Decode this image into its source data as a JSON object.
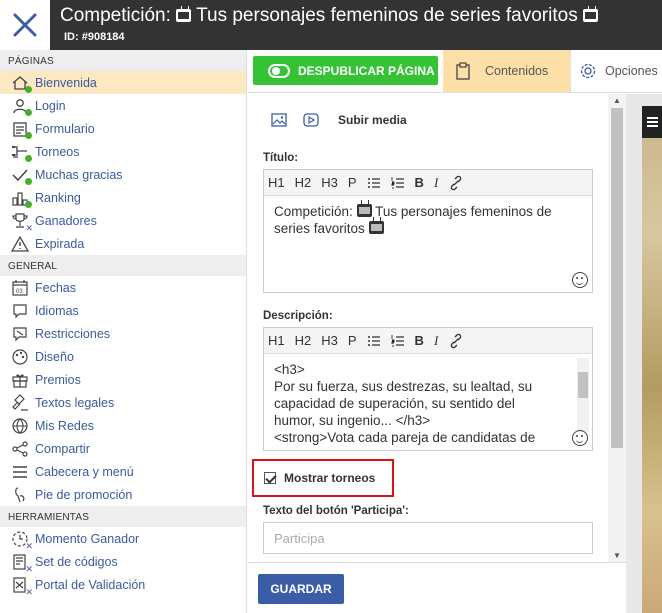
{
  "header": {
    "title_prefix": "Competición:",
    "title_suffix": "Tus personajes femeninos de series favoritos",
    "id_label": "ID: #908184"
  },
  "sidebar": {
    "sections": [
      {
        "label": "PÁGINAS",
        "items": [
          {
            "label": "Bienvenida",
            "icon": "home-icon",
            "marker": "dot",
            "active": true
          },
          {
            "label": "Login",
            "icon": "user-icon",
            "marker": "dot"
          },
          {
            "label": "Formulario",
            "icon": "form-icon",
            "marker": "dot"
          },
          {
            "label": "Torneos",
            "icon": "bracket-icon",
            "marker": "dot"
          },
          {
            "label": "Muchas gracias",
            "icon": "check-icon",
            "marker": "dot"
          },
          {
            "label": "Ranking",
            "icon": "ranking-icon",
            "marker": "dot"
          },
          {
            "label": "Ganadores",
            "icon": "trophy-icon",
            "marker": "x"
          },
          {
            "label": "Expirada",
            "icon": "warning-icon",
            "marker": "none"
          }
        ]
      },
      {
        "label": "GENERAL",
        "items": [
          {
            "label": "Fechas",
            "icon": "calendar-icon"
          },
          {
            "label": "Idiomas",
            "icon": "speech-icon"
          },
          {
            "label": "Restricciones",
            "icon": "restriction-icon"
          },
          {
            "label": "Diseño",
            "icon": "palette-icon"
          },
          {
            "label": "Premios",
            "icon": "gift-icon"
          },
          {
            "label": "Textos legales",
            "icon": "gavel-icon"
          },
          {
            "label": "Mis Redes",
            "icon": "globe-icon"
          },
          {
            "label": "Compartir",
            "icon": "share-icon"
          },
          {
            "label": "Cabecera y menú",
            "icon": "menu-icon"
          },
          {
            "label": "Pie de promoción",
            "icon": "footer-icon"
          }
        ]
      },
      {
        "label": "HERRAMIENTAS",
        "items": [
          {
            "label": "Momento Ganador",
            "icon": "clock-icon",
            "marker": "x"
          },
          {
            "label": "Set de códigos",
            "icon": "codes-icon",
            "marker": "x"
          },
          {
            "label": "Portal de Validación",
            "icon": "portal-icon",
            "marker": "x"
          }
        ]
      }
    ]
  },
  "topbar": {
    "publish_label": "DESPUBLICAR PÁGINA",
    "tab_contents": "Contenidos",
    "tab_options": "Opciones"
  },
  "content": {
    "upload_media": "Subir media",
    "title_label": "Título:",
    "title_text": "Competición:",
    "title_text_2": "Tus personajes femeninos de series favoritos",
    "toolbar": [
      "H1",
      "H2",
      "H3",
      "P"
    ],
    "description_label": "Descripción:",
    "description_lines": [
      "<h3>",
      "Por su fuerza, sus destrezas, su lealtad, su",
      "capacidad de superación, su sentido del",
      "humor, su ingenio... </h3>",
      "<strong>Vota cada pareja de candidatas de"
    ],
    "show_tournaments_label": "Mostrar torneos",
    "show_tournaments_checked": true,
    "participate_label": "Texto del botón 'Participa':",
    "participate_placeholder": "Participa"
  },
  "footer": {
    "save_label": "GUARDAR"
  },
  "colors": {
    "header_bg": "#333333",
    "publish_green": "#35c335",
    "active_tab": "#fde0a8",
    "active_nav": "#fde8c4",
    "link_blue": "#3b5b9b",
    "save_blue": "#3b5da8",
    "highlight_red": "#d9141a"
  }
}
